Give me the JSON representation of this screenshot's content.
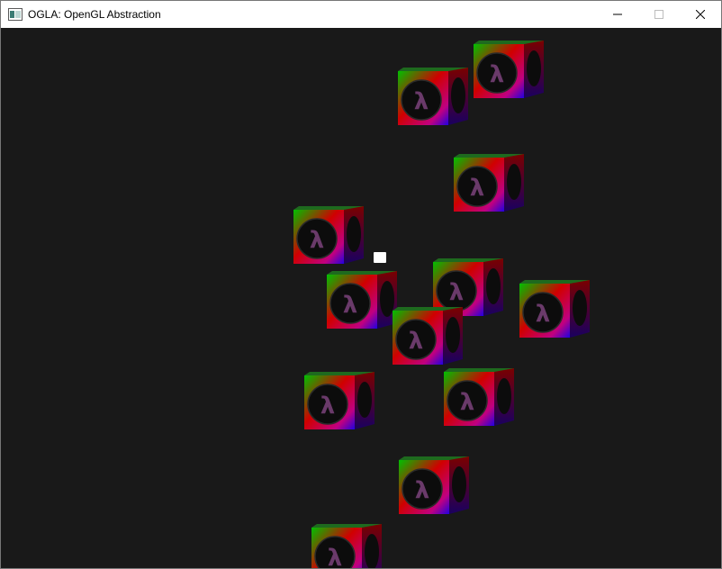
{
  "window": {
    "title": "OGLA: OpenGL Abstraction",
    "icon": "app-window-icon",
    "controls": {
      "minimize_icon": "minimize-icon",
      "maximize_icon": "maximize-icon",
      "close_icon": "close-icon"
    }
  },
  "scene": {
    "background": "#191919",
    "cube_count": 12,
    "cube_logo_glyph": "λ",
    "cube_colors": [
      "#00c000",
      "#d00000",
      "#2000e0",
      "#c00080"
    ]
  }
}
